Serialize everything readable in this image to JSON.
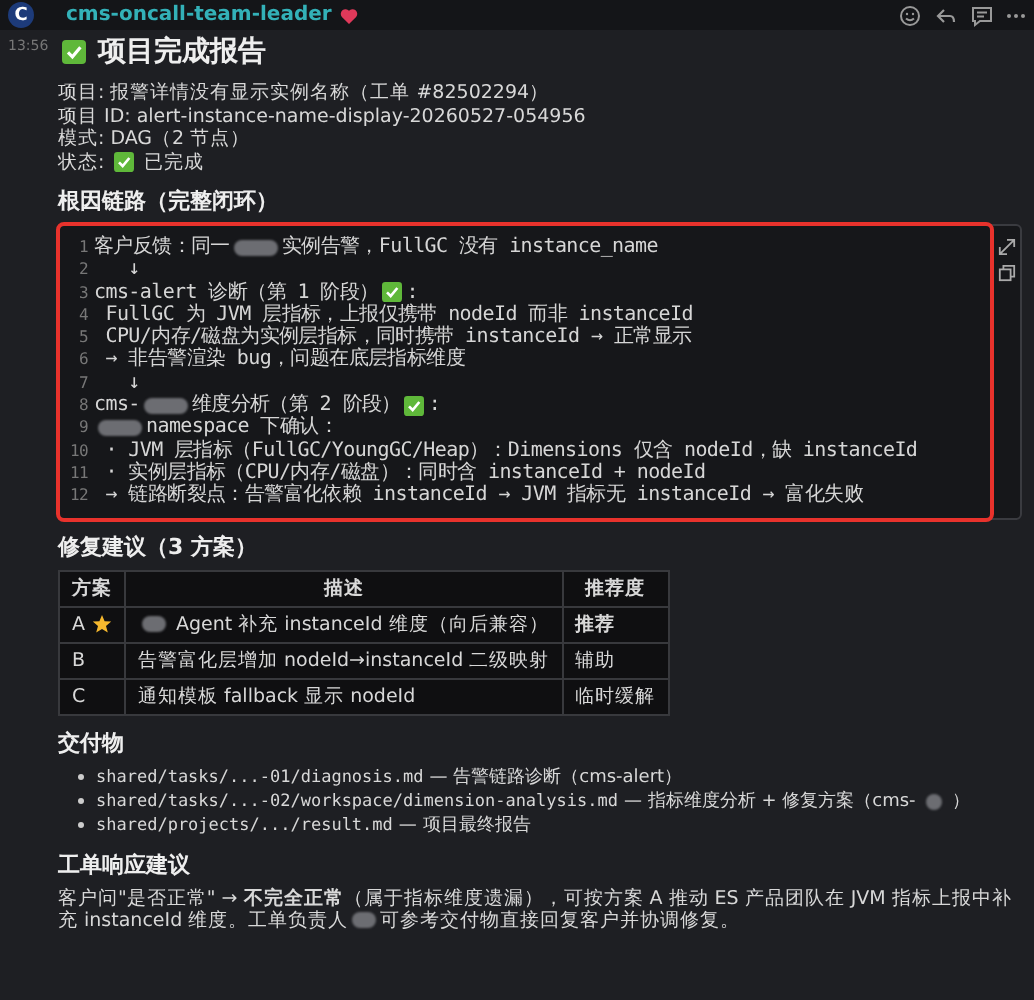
{
  "header": {
    "avatar": "C",
    "sender": "cms-oncall-team-leader"
  },
  "message": {
    "time": "13:56",
    "title": "项目完成报告",
    "info": [
      {
        "label": "项目:",
        "parts": [
          {
            "kind": "text",
            "text": "报警详情没有显示实例名称（工单 #82502294）"
          }
        ]
      },
      {
        "label": "项目 ID:",
        "parts": [
          {
            "kind": "text",
            "text": "alert-instance-name-display-20260527-054956"
          }
        ]
      },
      {
        "label": "模式:",
        "parts": [
          {
            "kind": "text",
            "text": "DAG（2 节点）"
          }
        ]
      },
      {
        "label": "状态:",
        "parts": [
          {
            "kind": "check"
          },
          {
            "kind": "text",
            "text": "已完成"
          }
        ]
      }
    ],
    "root_cause": {
      "heading": "根因链路（完整闭环）",
      "highlighted": true,
      "lines": [
        {
          "n": "1",
          "parts": [
            {
              "kind": "text",
              "text": "客户反馈：同一"
            },
            {
              "kind": "blur"
            },
            {
              "kind": "text",
              "text": "实例告警，FullGC 没有 instance_name"
            }
          ]
        },
        {
          "n": "2",
          "parts": [
            {
              "kind": "text",
              "text": "   ↓"
            }
          ]
        },
        {
          "n": "3",
          "parts": [
            {
              "kind": "text",
              "text": "cms-alert 诊断（第 1 阶段）"
            },
            {
              "kind": "check"
            },
            {
              "kind": "text",
              "text": ":"
            }
          ]
        },
        {
          "n": "4",
          "parts": [
            {
              "kind": "text",
              "text": " FullGC 为 JVM 层指标，上报仅携带 nodeId 而非 instanceId"
            }
          ]
        },
        {
          "n": "5",
          "parts": [
            {
              "kind": "text",
              "text": " CPU/内存/磁盘为实例层指标，同时携带 instanceId → 正常显示"
            }
          ]
        },
        {
          "n": "6",
          "parts": [
            {
              "kind": "text",
              "text": " → 非告警渲染 bug，问题在底层指标维度"
            }
          ]
        },
        {
          "n": "7",
          "parts": [
            {
              "kind": "text",
              "text": "   ↓"
            }
          ]
        },
        {
          "n": "8",
          "parts": [
            {
              "kind": "text",
              "text": "cms-"
            },
            {
              "kind": "blur"
            },
            {
              "kind": "text",
              "text": "维度分析（第 2 阶段）"
            },
            {
              "kind": "check"
            },
            {
              "kind": "text",
              "text": ":"
            }
          ]
        },
        {
          "n": "9",
          "parts": [
            {
              "kind": "blur"
            },
            {
              "kind": "text",
              "text": "namespace 下确认："
            }
          ]
        },
        {
          "n": "10",
          "parts": [
            {
              "kind": "text",
              "text": " · JVM 层指标（FullGC/YoungGC/Heap）：Dimensions 仅含 nodeId，缺 instanceId"
            }
          ]
        },
        {
          "n": "11",
          "parts": [
            {
              "kind": "text",
              "text": " · 实例层指标（CPU/内存/磁盘）：同时含 instanceId + nodeId"
            }
          ]
        },
        {
          "n": "12",
          "parts": [
            {
              "kind": "text",
              "text": " → 链路断裂点：告警富化依赖 instanceId → JVM 指标无 instanceId → 富化失败"
            }
          ]
        }
      ]
    },
    "fixes": {
      "heading": "修复建议（3 方案）",
      "columns": [
        "方案",
        "描述",
        "推荐度"
      ],
      "rows": [
        {
          "plan": "A",
          "starred": true,
          "parts": [
            {
              "kind": "blur"
            },
            {
              "kind": "text",
              "text": "Agent 补充 instanceId 维度（向后兼容）"
            }
          ],
          "level": "推荐",
          "strong": true
        },
        {
          "plan": "B",
          "starred": false,
          "parts": [
            {
              "kind": "text",
              "text": "告警富化层增加 nodeId→instanceId 二级映射"
            }
          ],
          "level": "辅助",
          "strong": false
        },
        {
          "plan": "C",
          "starred": false,
          "parts": [
            {
              "kind": "text",
              "text": "通知模板 fallback 显示 nodeId"
            }
          ],
          "level": "临时缓解",
          "strong": false
        }
      ]
    },
    "deliverables": {
      "heading": "交付物",
      "items": [
        {
          "path": "shared/tasks/...-01/diagnosis.md",
          "parts": [
            {
              "kind": "text",
              "text": "— 告警链路诊断（cms-alert）"
            }
          ]
        },
        {
          "path": "shared/tasks/...-02/workspace/dimension-analysis.md",
          "parts": [
            {
              "kind": "text",
              "text": "— 指标维度分析 + 修复方案（cms-"
            },
            {
              "kind": "blur"
            },
            {
              "kind": "text",
              "text": "）"
            }
          ]
        },
        {
          "path": "shared/projects/.../result.md",
          "parts": [
            {
              "kind": "text",
              "text": "— 项目最终报告"
            }
          ]
        }
      ]
    },
    "response": {
      "heading": "工单响应建议",
      "parts": [
        {
          "kind": "text",
          "text": "客户问\"是否正常\" → **不完全正常**（属于指标维度遗漏），可按方案 A 推动 ES 产品团队在 JVM 指标上报中补充 instanceId 维度。工单负责人"
        },
        {
          "kind": "blur"
        },
        {
          "kind": "text",
          "text": "可参考交付物直接回复客户并协调修复。"
        }
      ]
    }
  }
}
